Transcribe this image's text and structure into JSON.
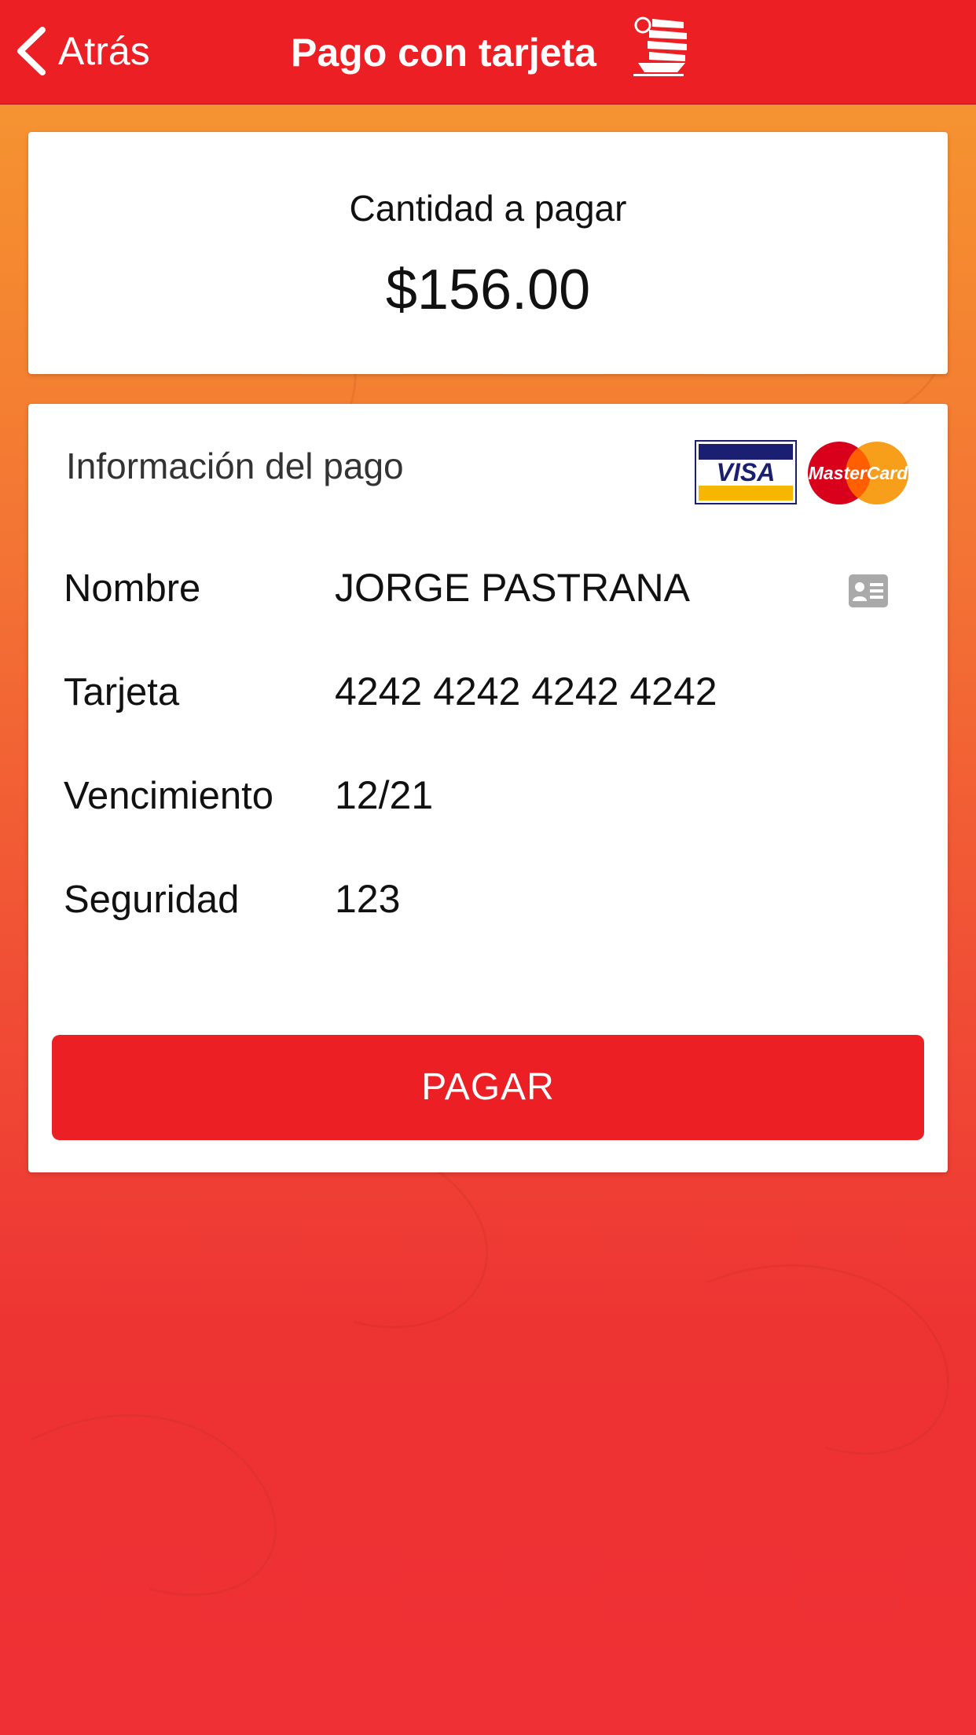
{
  "navbar": {
    "back_label": "Atrás",
    "title": "Pago con tarjeta"
  },
  "amount": {
    "label": "Cantidad a pagar",
    "value": "$156.00"
  },
  "payment": {
    "section_title": "Información del pago",
    "card_brands": {
      "visa": "VISA",
      "mastercard": "MasterCard"
    },
    "fields": {
      "name": {
        "label": "Nombre",
        "value": "JORGE PASTRANA"
      },
      "card": {
        "label": "Tarjeta",
        "value": "4242 4242 4242 4242"
      },
      "expiry": {
        "label": "Vencimiento",
        "value": "12/21"
      },
      "security": {
        "label": "Seguridad",
        "value": "123"
      }
    },
    "pay_button_label": "PAGAR"
  },
  "colors": {
    "brand_red": "#ec1f24",
    "background_top": "#f59a33",
    "background_bottom": "#ef3035",
    "visa_blue": "#1a1f71",
    "visa_gold": "#f7b600",
    "mastercard_red": "#eb001b",
    "mastercard_orange": "#f79e1b"
  },
  "icons": {
    "back": "chevron-left-icon",
    "logo": "junk-boat-logo",
    "contact": "contact-card-icon"
  }
}
